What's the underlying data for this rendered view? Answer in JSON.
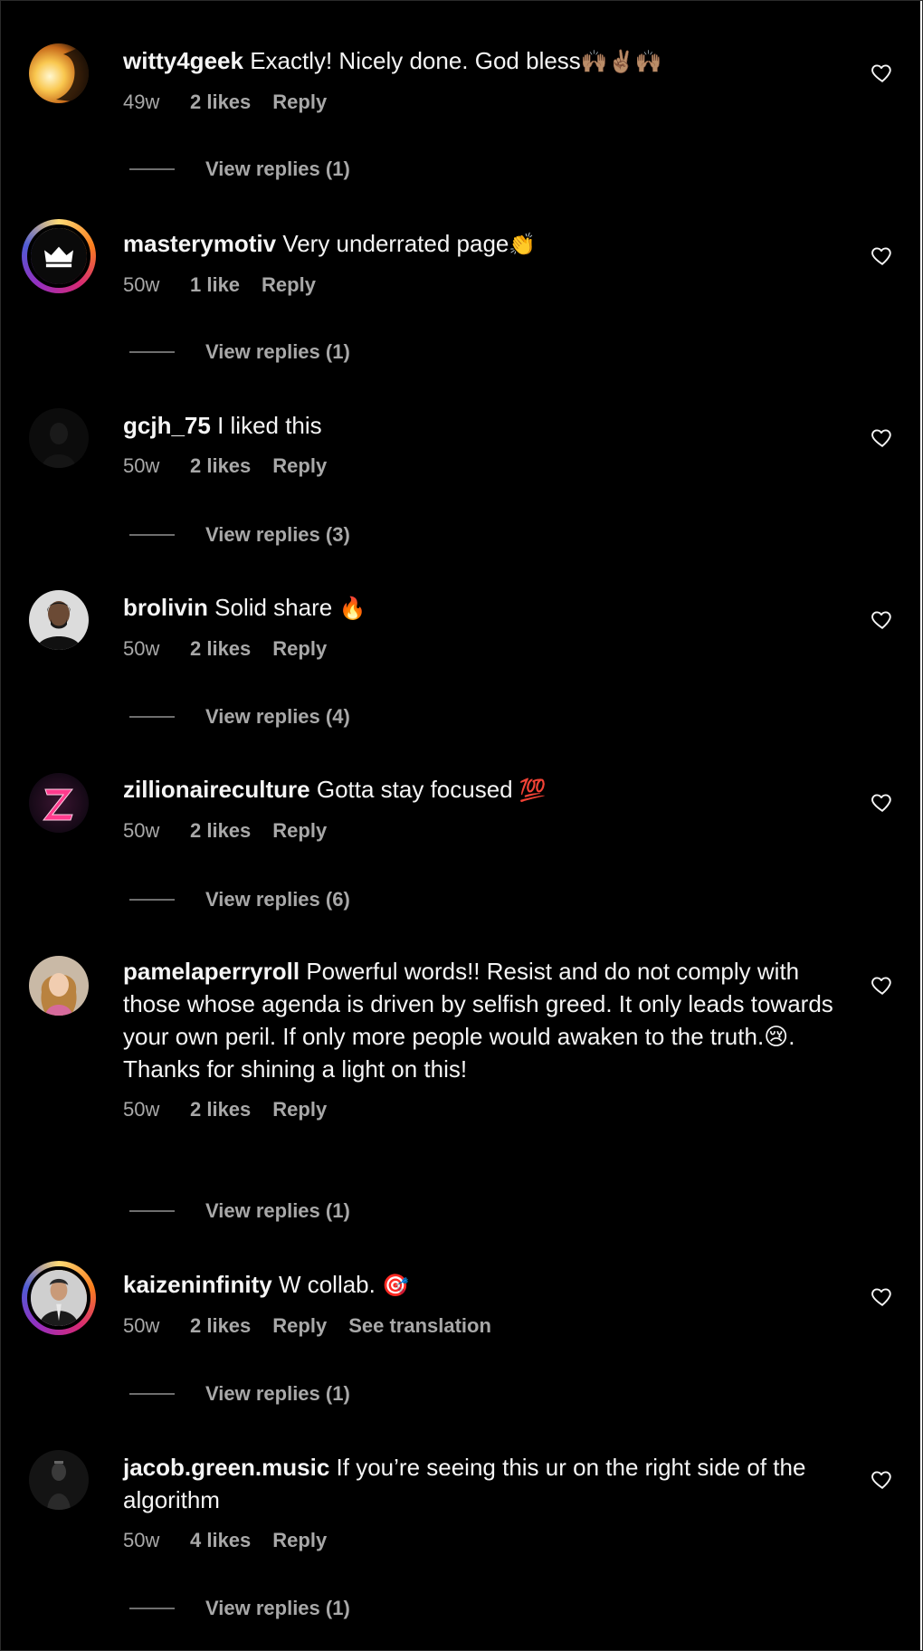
{
  "comments": [
    {
      "username": "witty4geek",
      "text": "Exactly! Nicely done. God bless",
      "emoji": "🙌🏽✌🏽🙌🏽",
      "time": "49w",
      "likes": "2 likes",
      "reply": "Reply",
      "view_replies": "View replies (1)",
      "avatar_icon": "sunset-avatar-icon"
    },
    {
      "username": "masterymotiv",
      "text": "Very underrated page",
      "emoji": "👏",
      "time": "50w",
      "likes": "1 like",
      "reply": "Reply",
      "view_replies": "View replies (1)",
      "avatar_icon": "crown-avatar-icon"
    },
    {
      "username": "gcjh_75",
      "text": "I liked this",
      "emoji": "",
      "time": "50w",
      "likes": "2 likes",
      "reply": "Reply",
      "view_replies": "View replies (3)",
      "avatar_icon": "dark-avatar-icon"
    },
    {
      "username": "brolivin",
      "text": "Solid share",
      "emoji": "🔥",
      "time": "50w",
      "likes": "2 likes",
      "reply": "Reply",
      "view_replies": "View replies (4)",
      "avatar_icon": "person-avatar-icon"
    },
    {
      "username": "zillionaireculture",
      "text": "Gotta stay focused",
      "emoji": "💯",
      "time": "50w",
      "likes": "2 likes",
      "reply": "Reply",
      "view_replies": "View replies (6)",
      "avatar_icon": "z-logo-avatar-icon"
    },
    {
      "username": "pamelaperryroll",
      "text": "Powerful words!! Resist and do not comply with those whose agenda is driven by selfish greed. It only leads towards your own peril. If only more people would awaken to the truth.😢. Thanks for shining a light on this!",
      "emoji": "",
      "time": "50w",
      "likes": "2 likes",
      "reply": "Reply",
      "view_replies": "View replies (1)",
      "avatar_icon": "woman-avatar-icon"
    },
    {
      "username": "kaizeninfinity",
      "text": "W collab.",
      "emoji": "🎯",
      "time": "50w",
      "likes": "2 likes",
      "reply": "Reply",
      "see_translation": "See translation",
      "view_replies": "View replies (1)",
      "avatar_icon": "man-avatar-icon"
    },
    {
      "username": "jacob.green.music",
      "text": "If you’re seeing this ur on the right side of the algorithm",
      "emoji": "",
      "time": "50w",
      "likes": "4 likes",
      "reply": "Reply",
      "view_replies": "View replies (1)",
      "avatar_icon": "musician-avatar-icon"
    }
  ]
}
